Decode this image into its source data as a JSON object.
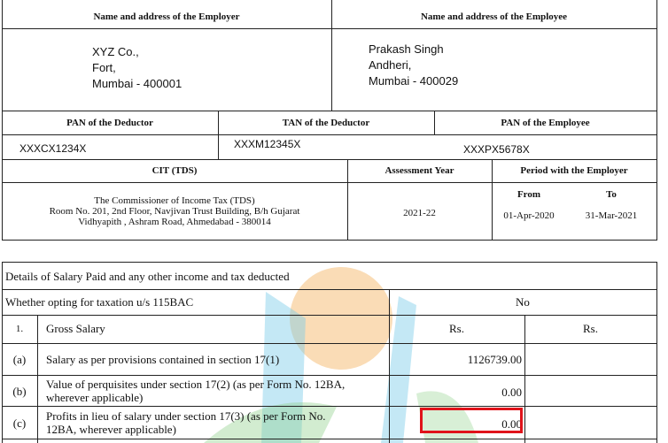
{
  "header": {
    "employer_label": "Name and address of the Employer",
    "employee_label": "Name and address of the Employee"
  },
  "employer": {
    "line1": "XYZ Co.,",
    "line2": "Fort,",
    "line3": "Mumbai - 400001"
  },
  "employee": {
    "line1": "Prakash Singh",
    "line2": "Andheri,",
    "line3": "Mumbai - 400029"
  },
  "ids": {
    "pan_deductor_label": "PAN of the Deductor",
    "tan_deductor_label": "TAN of the Deductor",
    "pan_employee_label": "PAN of the Employee",
    "pan_deductor": "XXXCX1234X",
    "tan_deductor": "XXXM12345X",
    "pan_employee": "XXXPX5678X"
  },
  "cit": {
    "label": "CIT (TDS)",
    "assessment_label": "Assessment Year",
    "period_label": "Period with the Employer",
    "from_label": "From",
    "to_label": "To",
    "address_line1": "The Commissioner of Income Tax (TDS)",
    "address_line2": "Room No. 201, 2nd Floor, Navjivan Trust Building, B/h Gujarat",
    "address_line3": "Vidhyapith , Ashram Road, Ahmedabad - 380014",
    "assessment_year": "2021-22",
    "from": "01-Apr-2020",
    "to": "31-Mar-2021"
  },
  "salary": {
    "section_title": "Details of Salary Paid and any other income and tax deducted",
    "opting_label": "Whether opting for taxation u/s 115BAC",
    "opting_value": "No",
    "rows": [
      {
        "num": "1.",
        "desc1": "Gross Salary",
        "desc2": "",
        "rs1": "Rs.",
        "rs2": "Rs."
      },
      {
        "num": "(a)",
        "desc1": "Salary as per provisions contained in section 17(1)",
        "desc2": "",
        "rs1": "1126739.00",
        "rs2": ""
      },
      {
        "num": "(b)",
        "desc1": "Value of perquisites under section 17(2) (as per Form No. 12BA,",
        "desc2": "wherever applicable)",
        "rs1": "0.00",
        "rs2": ""
      },
      {
        "num": "(c)",
        "desc1": "Profits in lieu of salary under section 17(3) (as per Form No.",
        "desc2": "12BA, wherever applicable)",
        "rs1": "0.00",
        "rs2": ""
      }
    ]
  },
  "colors": {
    "highlight": "#e0131b",
    "wm_orange": "#f6c07a",
    "wm_blue": "#7ccbe9",
    "wm_green": "#8fd08a"
  }
}
